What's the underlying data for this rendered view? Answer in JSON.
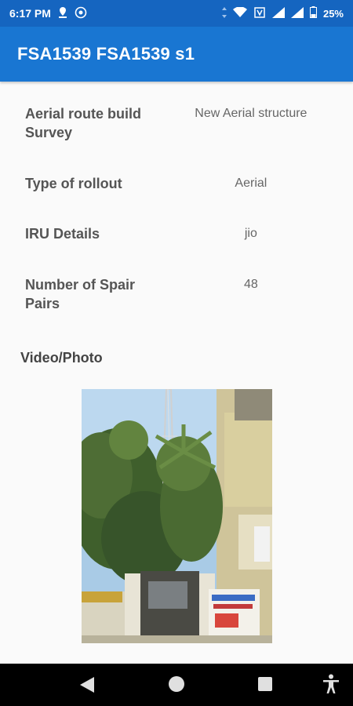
{
  "status_bar": {
    "time": "6:17 PM",
    "battery": "25%",
    "icons": [
      "location-icon",
      "whatsapp-icon",
      "data-arrows-icon",
      "wifi-icon",
      "volte-icon",
      "signal-icon",
      "signal-icon",
      "battery-icon"
    ]
  },
  "app_bar": {
    "title": "FSA1539 FSA1539 s1"
  },
  "details": [
    {
      "label": "Aerial route build Survey",
      "value": "New Aerial structure"
    },
    {
      "label": "Type of rollout",
      "value": "Aerial"
    },
    {
      "label": "IRU Details",
      "value": "jio"
    },
    {
      "label": "Number of Spair Pairs",
      "value": "48"
    }
  ],
  "media": {
    "section_label": "Video/Photo",
    "photo_description": "photo of a telecom tower behind trees next to a building"
  },
  "nav_bar": {
    "icons": [
      "back-icon",
      "home-icon",
      "recents-icon",
      "accessibility-icon"
    ]
  },
  "colors": {
    "status_bar": "#1565c0",
    "app_bar": "#1976d2",
    "background": "#fafafa"
  }
}
